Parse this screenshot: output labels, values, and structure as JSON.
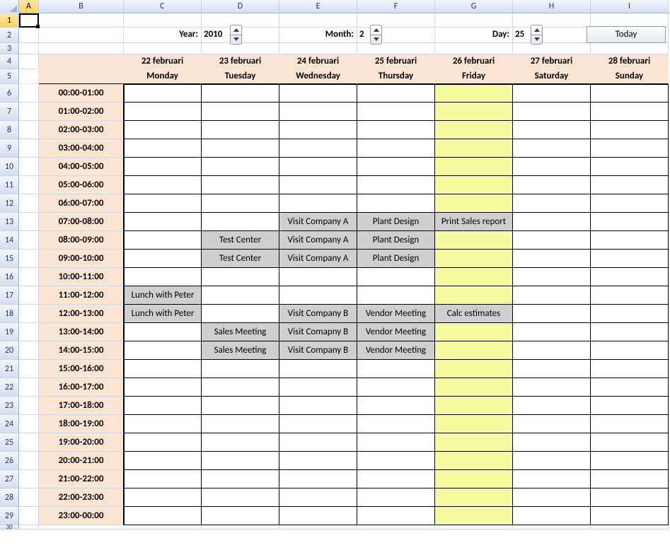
{
  "columns": [
    "A",
    "B",
    "C",
    "D",
    "E",
    "F",
    "G",
    "H",
    "I"
  ],
  "selected_cell": "A1",
  "controls": {
    "year_label": "Year:",
    "year_value": "2010",
    "month_label": "Month:",
    "month_value": "2",
    "day_label": "Day:",
    "day_value": "25",
    "today_button": "Today"
  },
  "header_dates": [
    "22 februari",
    "23 februari",
    "24 februari",
    "25 februari",
    "26 februari",
    "27 februari",
    "28 februari"
  ],
  "header_days": [
    "Monday",
    "Tuesday",
    "Wednesday",
    "Thursday",
    "Friday",
    "Saturday",
    "Sunday"
  ],
  "today_col_index": 4,
  "time_slots": [
    "00:00-01:00",
    "01:00-02:00",
    "02:00-03:00",
    "03:00-04:00",
    "04:00-05:00",
    "05:00-06:00",
    "06:00-07:00",
    "07:00-08:00",
    "08:00-09:00",
    "09:00-10:00",
    "10:00-11:00",
    "11:00-12:00",
    "12:00-13:00",
    "13:00-14:00",
    "14:00-15:00",
    "15:00-16:00",
    "16:00-17:00",
    "17:00-18:00",
    "18:00-19:00",
    "19:00-20:00",
    "20:00-21:00",
    "21:00-22:00",
    "22:00-23:00",
    "23:00-00:00"
  ],
  "appointments": {
    "7": {
      "2": "Visit Company A",
      "3": "Plant Design",
      "4": "Print Sales report"
    },
    "8": {
      "1": "Test Center",
      "2": "Visit Company A",
      "3": "Plant Design"
    },
    "9": {
      "1": "Test Center",
      "2": "Visit Company A",
      "3": "Plant Design"
    },
    "11": {
      "0": "Lunch with Peter"
    },
    "12": {
      "0": "Lunch with Peter",
      "2": "Visit Company B",
      "3": "Vendor Meeting",
      "4": "Calc estimates"
    },
    "13": {
      "1": "Sales Meeting",
      "2": "Visit Comapny B",
      "3": "Vendor Meeting"
    },
    "14": {
      "1": "Sales Meeting",
      "2": "Visit Company B",
      "3": "Vendor Meeting"
    }
  }
}
